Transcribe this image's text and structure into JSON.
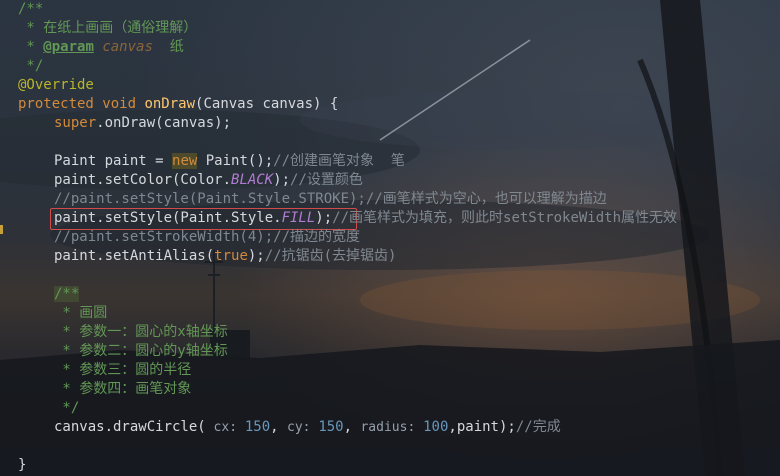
{
  "colors": {
    "comment": "#629755",
    "keyword": "#d38a3b",
    "annotation": "#bbb529",
    "method": "#ffc66d",
    "text": "#d5d9de",
    "field": "#b07cd1",
    "number": "#6897bb",
    "highlight_box": "#d24b4b"
  },
  "code": {
    "doc1": {
      "open": "/**",
      "l1": " * 在纸上画画（通俗理解）",
      "l2_star": " * ",
      "l2_tag": "@param",
      "l2_space": " ",
      "l2_name": "canvas",
      "l2_rest": "  纸",
      "close": " */"
    },
    "override": "@Override",
    "signature": {
      "protected": "protected",
      "void": "void",
      "name": "onDraw",
      "params": "(Canvas canvas) {"
    },
    "super_call": {
      "super": "super",
      "rest": ".onDraw(canvas);"
    },
    "paint_decl": {
      "a": "Paint paint = ",
      "new": "new",
      "b": " Paint();",
      "comment": "//创建画笔对象  笔"
    },
    "set_color": {
      "a": "paint.setColor(Color.",
      "field": "BLACK",
      "b": ");",
      "comment": "//设置颜色"
    },
    "stroke_line": {
      "code": "//paint.setStyle(Paint.Style.STROKE);",
      "comment": "//画笔样式为空心，也可以理解为描边"
    },
    "fill_line": {
      "a": "paint.setStyle(Paint.Style.",
      "field": "FILL",
      "b": ");",
      "comment": "//画笔样式为填充，则此时setStrokeWidth属性无效"
    },
    "stroke_width": {
      "code": "//paint.setStrokeWidth(4);",
      "comment": "//描边的宽度"
    },
    "anti_alias": {
      "a": "paint.setAntiAlias(",
      "kw": "true",
      "b": ");",
      "comment": "//抗锯齿(去掉锯齿)"
    },
    "doc2": {
      "open": "/**",
      "l1": " * 画圆",
      "l2": " * 参数一：圆心的x轴坐标",
      "l3": " * 参数二：圆心的y轴坐标",
      "l4": " * 参数三：圆的半径",
      "l5": " * 参数四：画笔对象",
      "close": " */"
    },
    "draw_circle": {
      "a": "canvas.drawCircle(",
      "hint_cx": " cx: ",
      "cx": "150",
      "sep1": ", ",
      "hint_cy": "cy: ",
      "cy": "150",
      "sep2": ", ",
      "hint_radius": "radius: ",
      "radius": "100",
      "b": ",paint);",
      "comment": "//完成"
    },
    "closing_brace": "}"
  }
}
